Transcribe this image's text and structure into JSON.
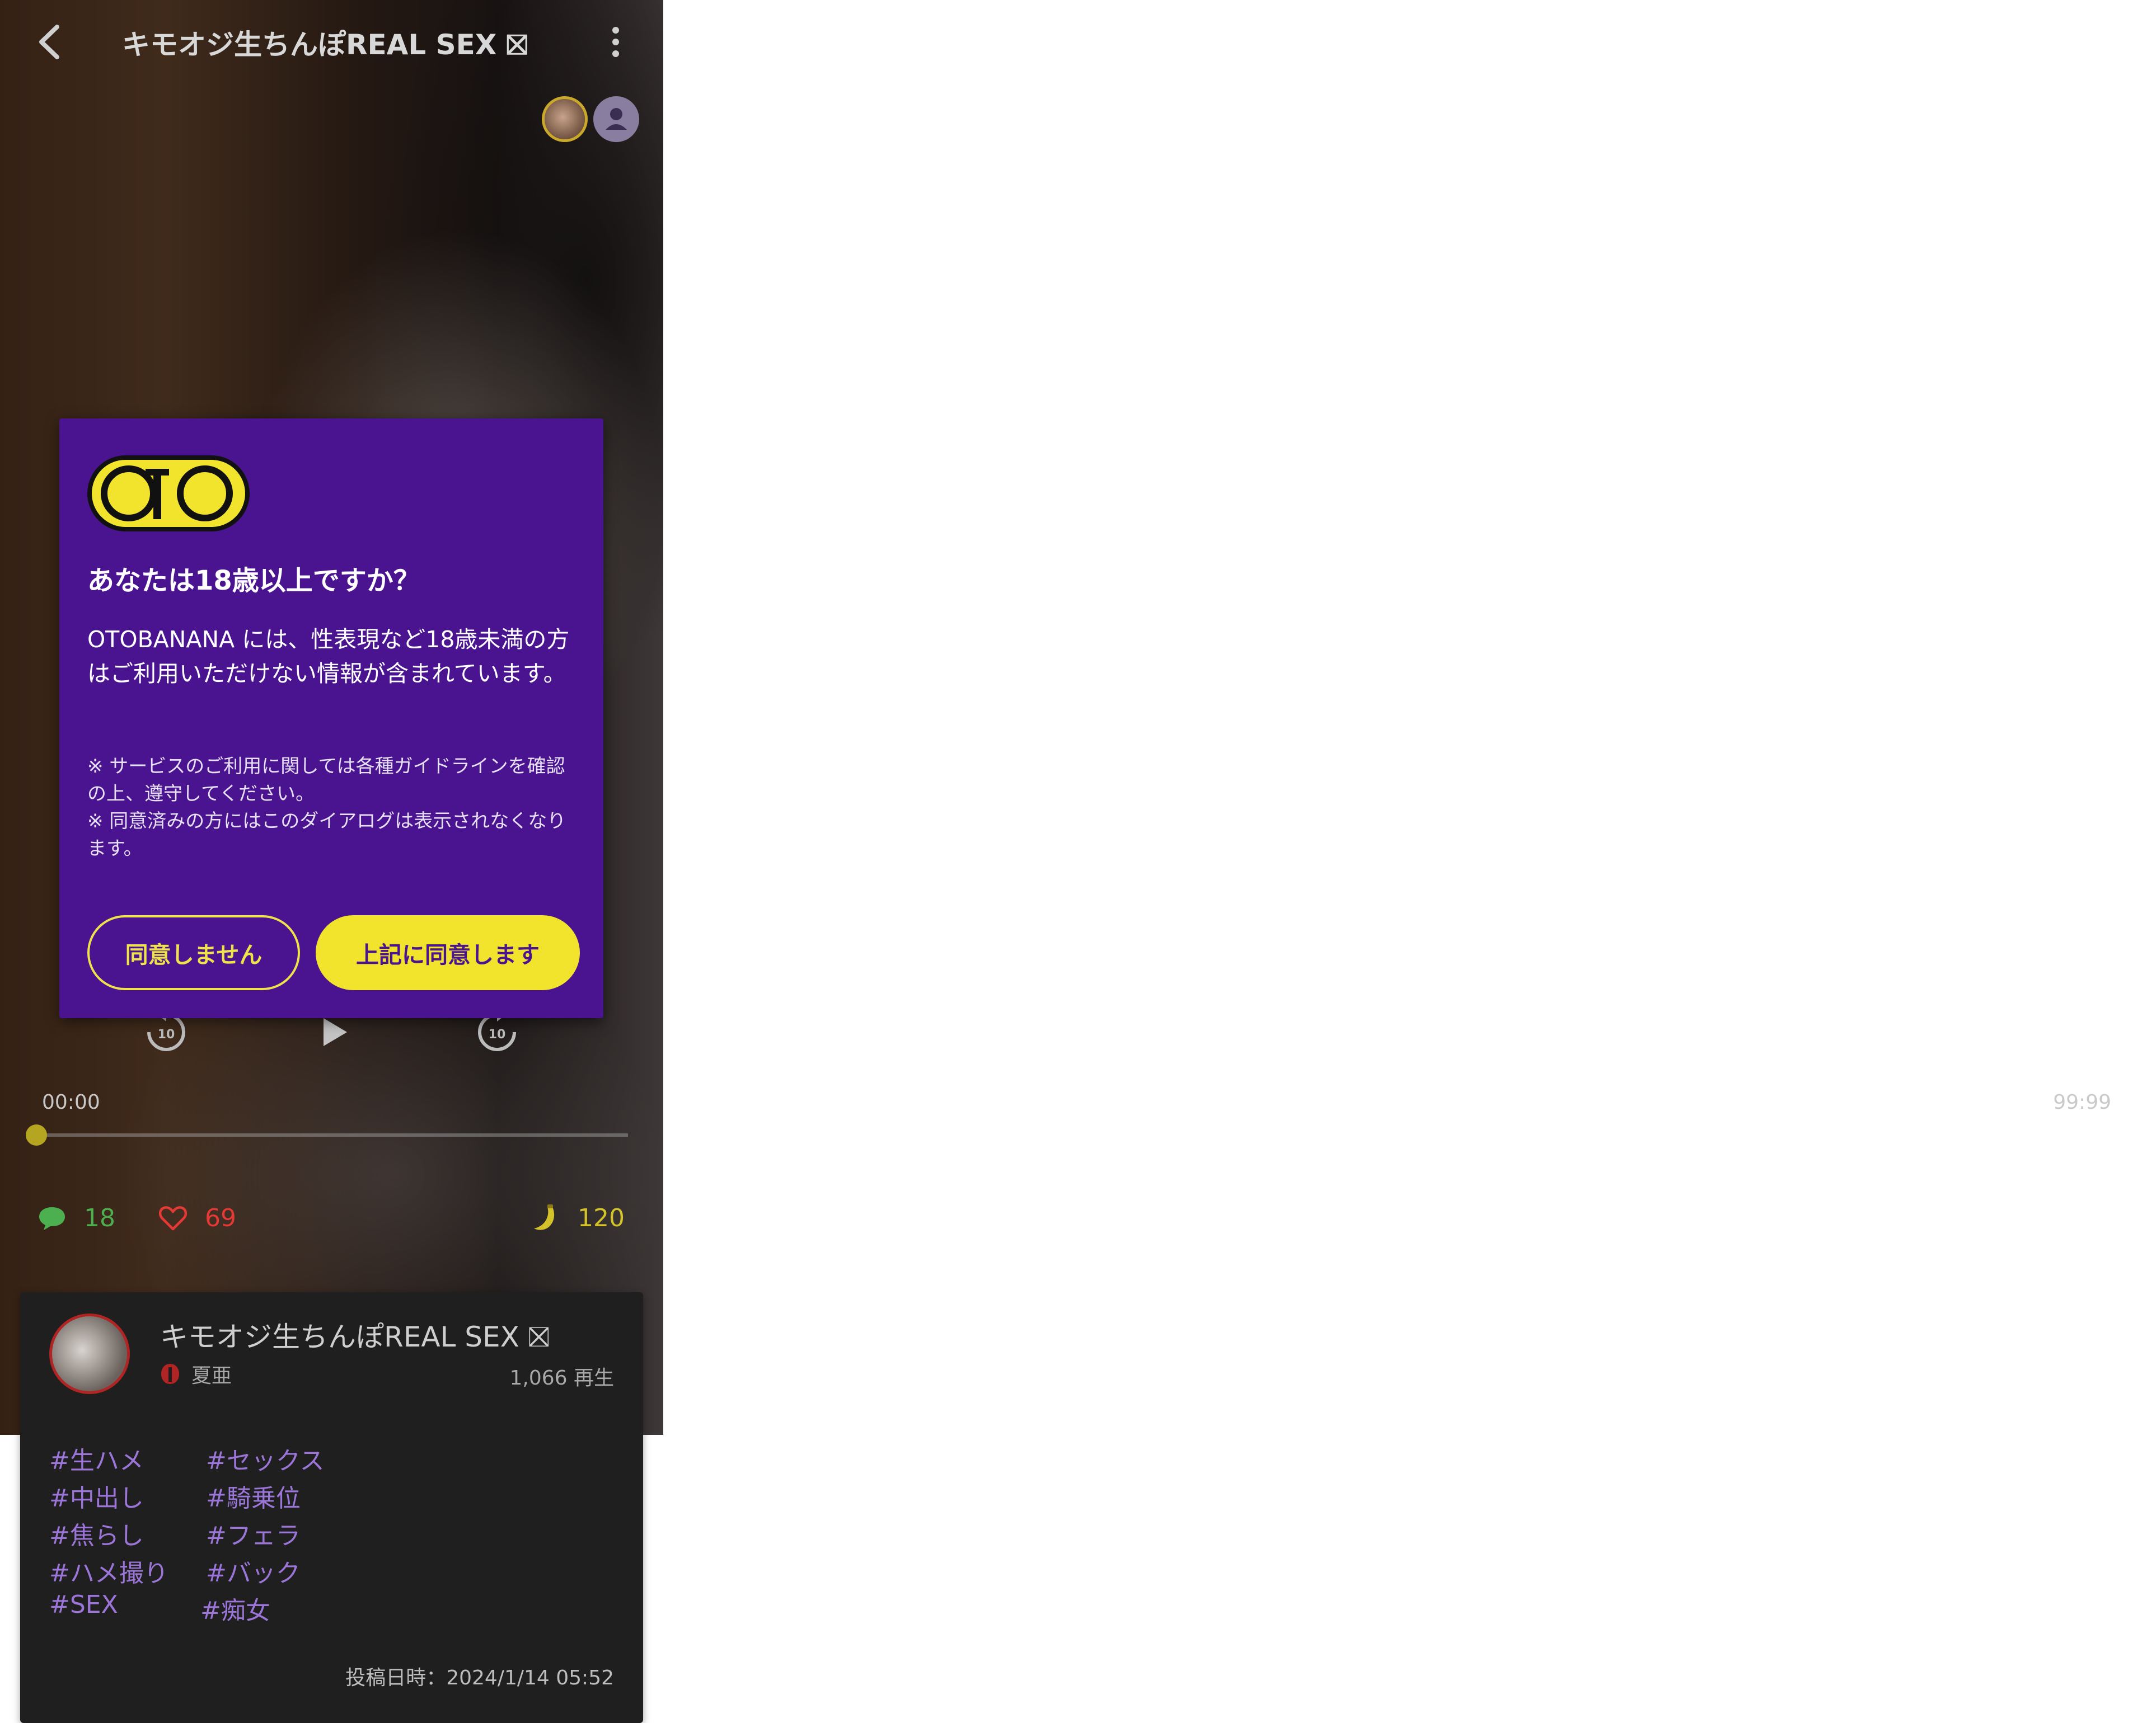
{
  "header": {
    "title": "キモオジ生ちんぽREAL SEX ⛝",
    "back_icon": "chevron-left-icon",
    "menu_icon": "more-vertical-icon"
  },
  "player": {
    "time_start": "00:00",
    "time_end": "99:99",
    "progress_fraction": 0.0,
    "controls": [
      "rewind-10-icon",
      "play-icon",
      "forward-10-icon"
    ],
    "rewind_label": "10",
    "forward_label": "10"
  },
  "stats": {
    "comments": "18",
    "likes": "69",
    "bananas": "120",
    "colors": {
      "comments": "#4caf50",
      "likes": "#e53935",
      "bananas": "#d4c22a"
    }
  },
  "dialog": {
    "logo_text": "OTO",
    "heading": "あなたは18歳以上ですか？",
    "body": "OTOBANANA には、性表現など18歳未満の方はご利用いただけない情報が含まれています。",
    "note": "※ サービスのご利用に関しては各種ガイドラインを確認の上、遵守してください。\n※ 同意済みの方にはこのダイアログは表示されなくなります。",
    "decline_label": "同意しません",
    "agree_label": "上記に同意します",
    "colors": {
      "background": "#4a1490",
      "accent": "#f2e42c"
    }
  },
  "card": {
    "title": "キモオジ生ちんぽREAL SEX ⛝",
    "author": "夏亜",
    "plays": "1,066 再生",
    "tags": [
      "#生ハメ",
      "#セックス",
      "#中出し",
      "#騎乗位",
      "#焦らし",
      "#フェラ",
      "#ハメ撮り",
      "#バック",
      "#SEX",
      "#痴女"
    ],
    "posted": "投稿日時：2024/1/14 05:52"
  }
}
